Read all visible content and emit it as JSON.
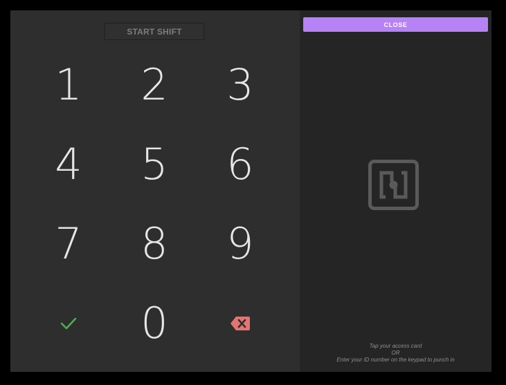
{
  "header": {
    "start_shift_label": "START SHIFT"
  },
  "keypad": {
    "keys": [
      "1",
      "2",
      "3",
      "4",
      "5",
      "6",
      "7",
      "8",
      "9",
      "",
      "0",
      ""
    ],
    "confirm_icon": "check-icon",
    "backspace_icon": "backspace-icon",
    "confirm_color": "#4caf50",
    "backspace_color": "#e57373"
  },
  "card_panel": {
    "close_label": "CLOSE",
    "accent_color": "#b682f5",
    "icon": "nfc-icon",
    "instructions": {
      "line1": "Tap your access card",
      "line2": "OR",
      "line3": "Enter your ID number on the keypad to punch in"
    }
  }
}
